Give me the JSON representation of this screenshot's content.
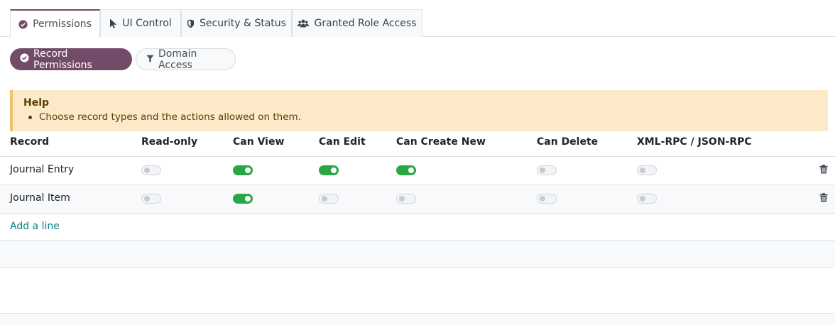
{
  "tabs": [
    {
      "label": "Permissions",
      "icon": "check-circle-icon",
      "active": true
    },
    {
      "label": "UI Control",
      "icon": "cursor-icon",
      "active": false
    },
    {
      "label": "Security & Status",
      "icon": "shield-icon",
      "active": false
    },
    {
      "label": "Granted Role Access",
      "icon": "users-icon",
      "active": false
    }
  ],
  "pills": [
    {
      "label": "Record Permissions",
      "icon": "check-circle-icon",
      "selected": true
    },
    {
      "label": "Domain Access",
      "icon": "filter-icon",
      "selected": false
    }
  ],
  "help": {
    "title": "Help",
    "items": [
      "Choose record types and the actions allowed on them."
    ]
  },
  "table": {
    "headers": [
      "Record",
      "Read-only",
      "Can View",
      "Can Edit",
      "Can Create New",
      "Can Delete",
      "XML-RPC / JSON-RPC"
    ],
    "rows": [
      {
        "record": "Journal Entry",
        "toggles": [
          false,
          true,
          true,
          true,
          false,
          false
        ]
      },
      {
        "record": "Journal Item",
        "toggles": [
          false,
          true,
          false,
          false,
          false,
          false
        ]
      }
    ],
    "add_line": "Add a line"
  },
  "colors": {
    "primary": "#714B67",
    "toggle_on": "#28a745",
    "link": "#017e84",
    "help_bg": "#fbe9c9"
  }
}
